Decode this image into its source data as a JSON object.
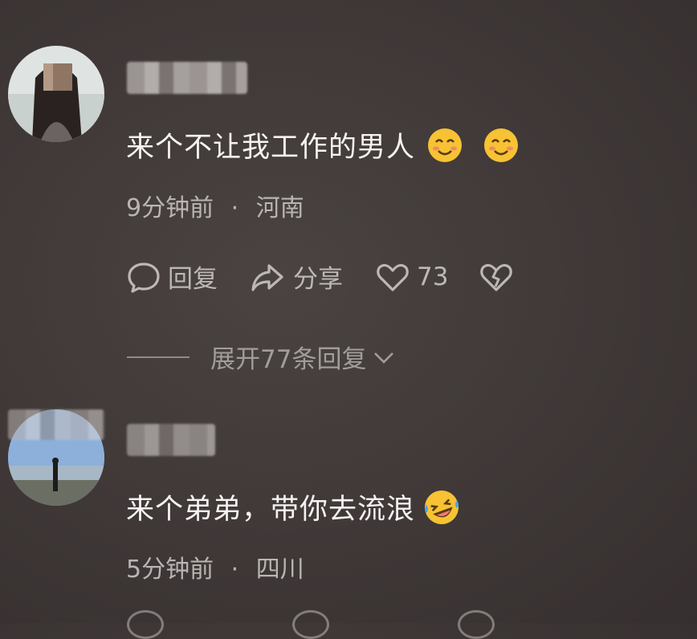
{
  "comments": [
    {
      "text": "来个不让我工作的男人",
      "emojis": [
        "smiling-blush-emoji",
        "smiling-blush-emoji"
      ],
      "time": "9分钟前",
      "separator": "·",
      "location": "河南",
      "actions": {
        "reply_label": "回复",
        "share_label": "分享",
        "like_count": "73"
      },
      "expand_label": "展开77条回复"
    },
    {
      "text": "来个弟弟，带你去流浪",
      "emojis": [
        "rofl-emoji"
      ],
      "time": "5分钟前",
      "separator": "·",
      "location": "四川"
    }
  ],
  "icons": {
    "reply": "speech-bubble-icon",
    "share": "share-arrow-icon",
    "like": "heart-icon",
    "dislike": "broken-heart-icon",
    "expand": "chevron-down-icon"
  },
  "colors": {
    "background": "#413a39",
    "primary_text": "#f5f3f2",
    "secondary_text": "#b9b5b4",
    "emoji_yellow": "#f7c233"
  }
}
